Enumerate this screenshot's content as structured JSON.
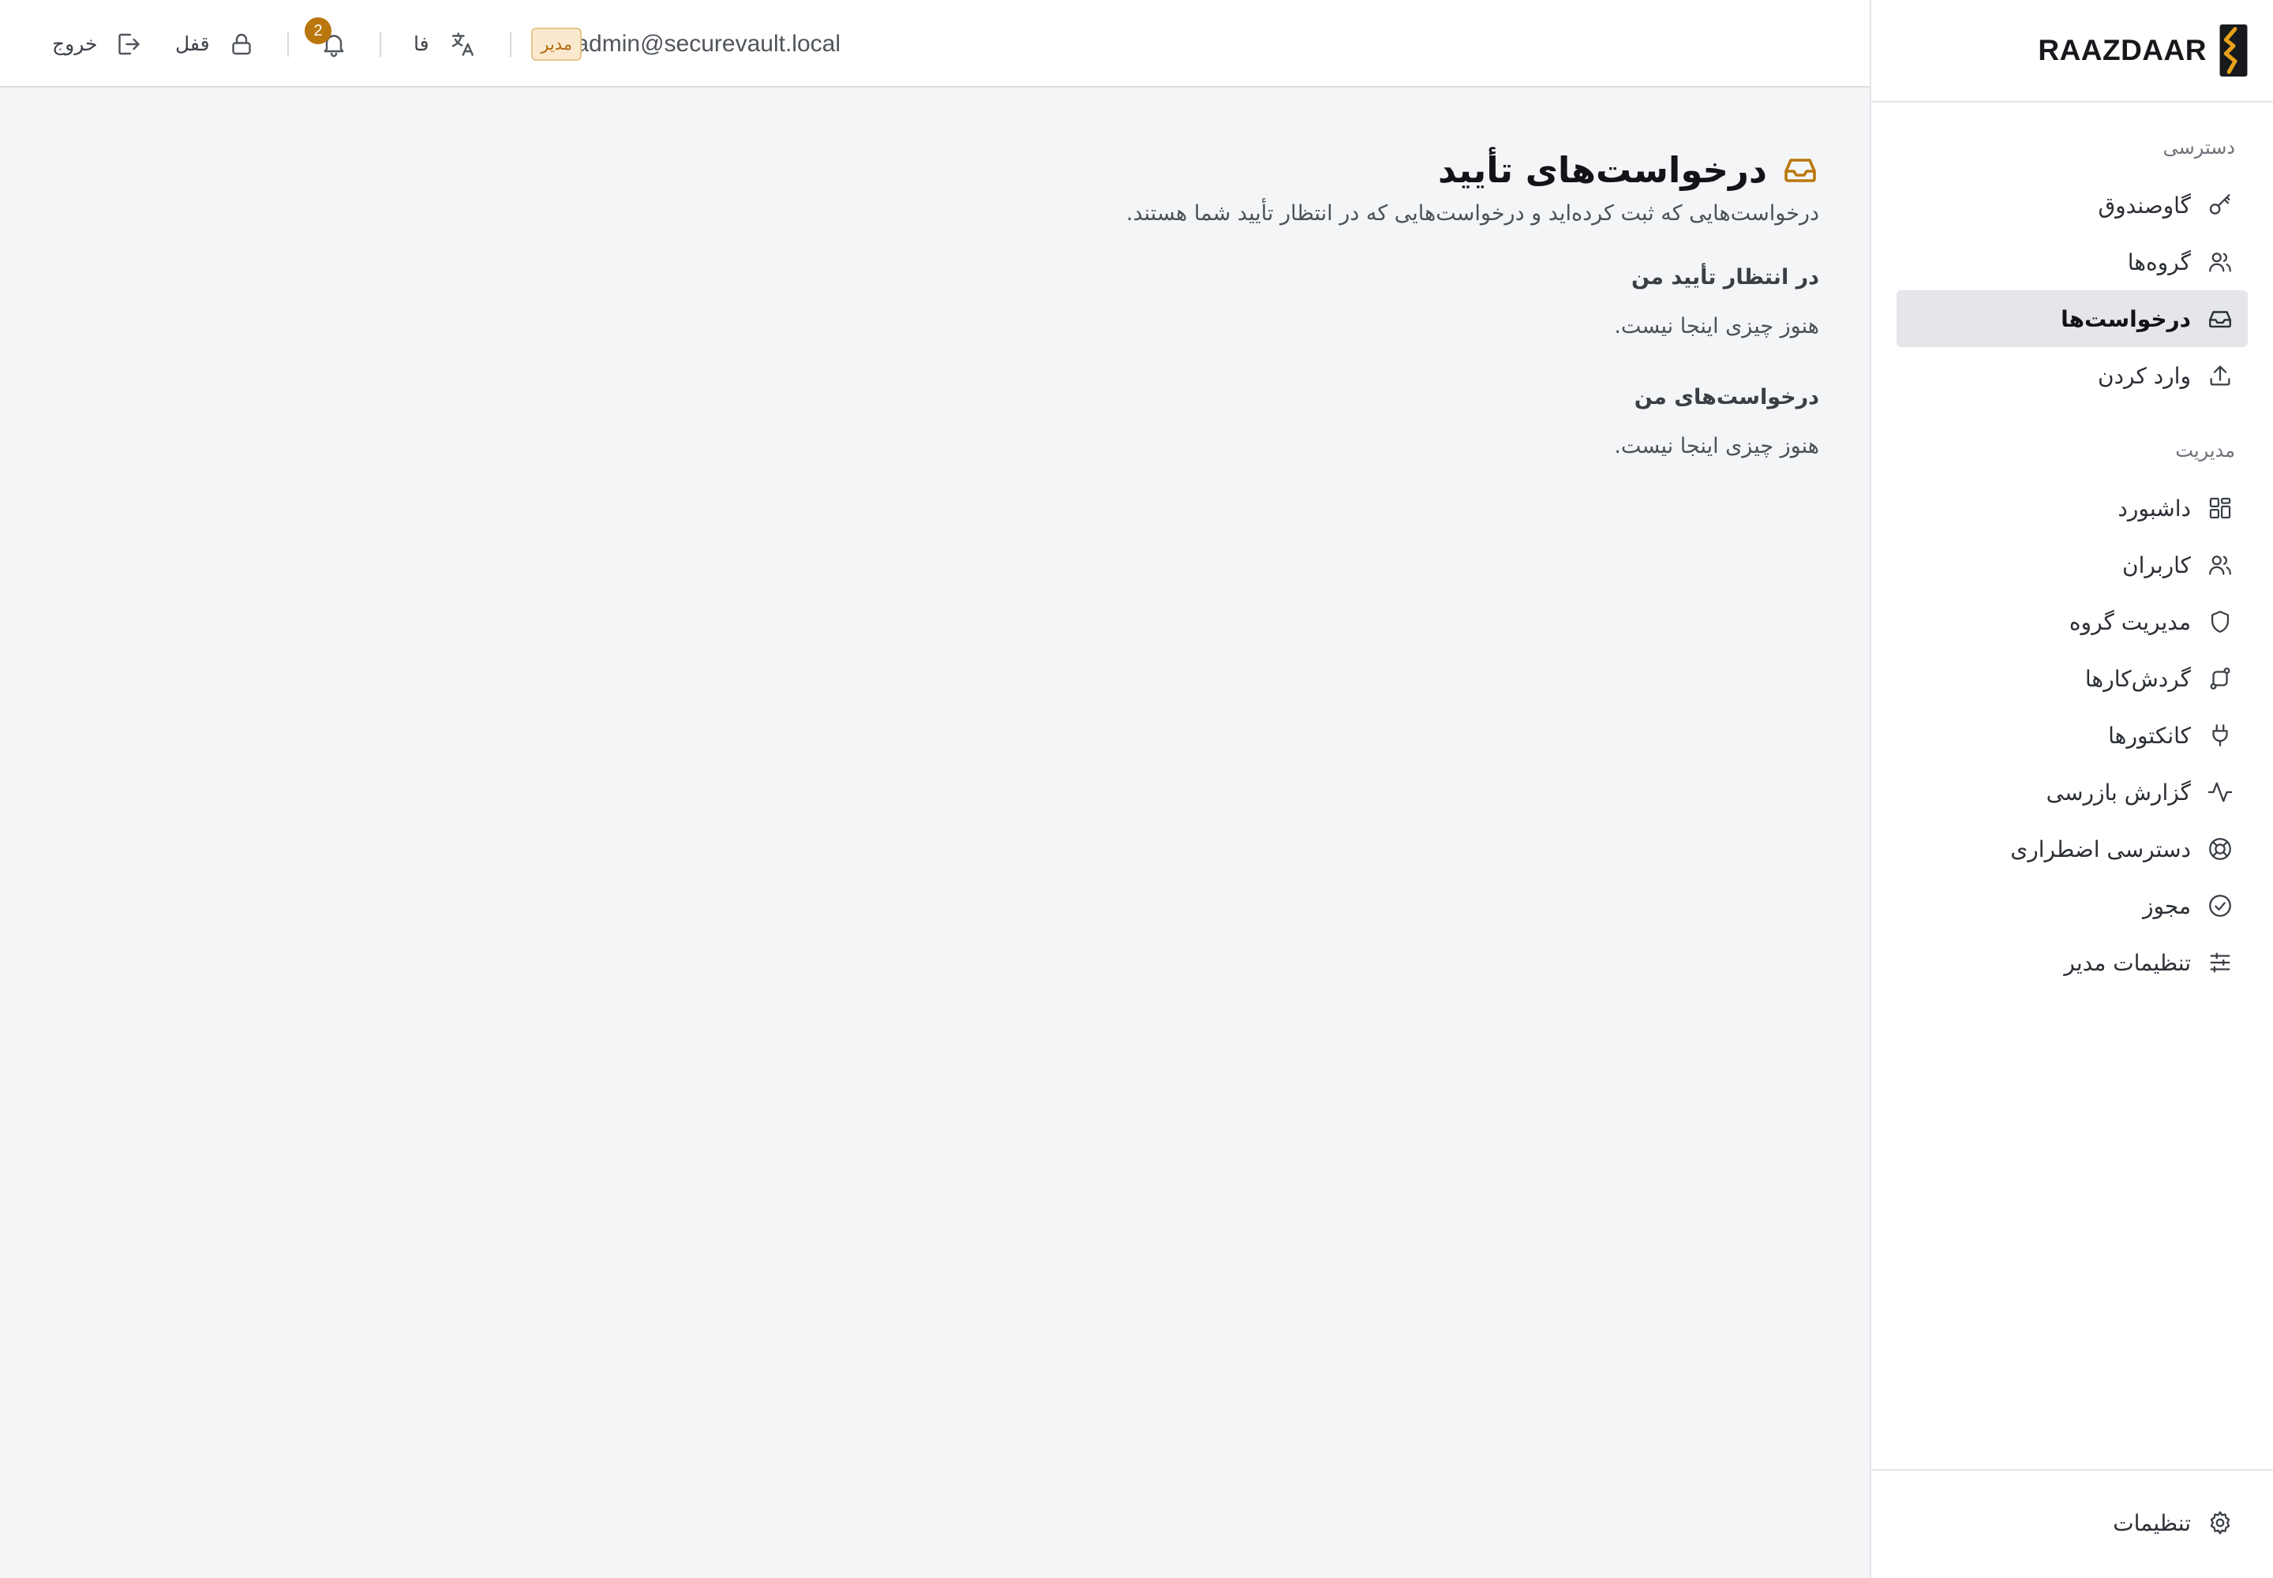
{
  "brand": {
    "name": "RAAZDAAR"
  },
  "header": {
    "email": "admin@securevault.local",
    "role_badge": "مدیر",
    "language": "فا",
    "notification_count": "2",
    "lock_label": "قفل",
    "logout_label": "خروج"
  },
  "sidebar": {
    "access_label": "دسترسی",
    "access_items": [
      {
        "label": "گاوصندوق",
        "icon": "key-icon"
      },
      {
        "label": "گروه‌ها",
        "icon": "users-icon"
      },
      {
        "label": "درخواست‌ها",
        "icon": "inbox-icon",
        "active": true
      },
      {
        "label": "وارد کردن",
        "icon": "upload-icon"
      }
    ],
    "admin_label": "مدیریت",
    "admin_items": [
      {
        "label": "داشبورد",
        "icon": "dashboard-icon"
      },
      {
        "label": "کاربران",
        "icon": "users-icon"
      },
      {
        "label": "مدیریت گروه",
        "icon": "shield-icon"
      },
      {
        "label": "گردش‌کارها",
        "icon": "workflow-icon"
      },
      {
        "label": "کانکتورها",
        "icon": "plug-icon"
      },
      {
        "label": "گزارش بازرسی",
        "icon": "activity-icon"
      },
      {
        "label": "دسترسی اضطراری",
        "icon": "lifebuoy-icon"
      },
      {
        "label": "مجوز",
        "icon": "badge-check-icon"
      },
      {
        "label": "تنظیمات مدیر",
        "icon": "sliders-icon"
      }
    ],
    "settings_label": "تنظیمات"
  },
  "main": {
    "title": "درخواست‌های تأیید",
    "subtitle": "درخواست‌هایی که ثبت کرده‌اید و درخواست‌هایی که در انتظار تأیید شما هستند.",
    "pending_heading": "در انتظار تأیید من",
    "pending_empty": "هنوز چیزی اینجا نیست.",
    "mine_heading": "درخواست‌های من",
    "mine_empty": "هنوز چیزی اینجا نیست."
  },
  "colors": {
    "accent": "#b9770e",
    "active_nav_bg": "#e4e6ea",
    "page_bg": "#f4f5f7"
  }
}
